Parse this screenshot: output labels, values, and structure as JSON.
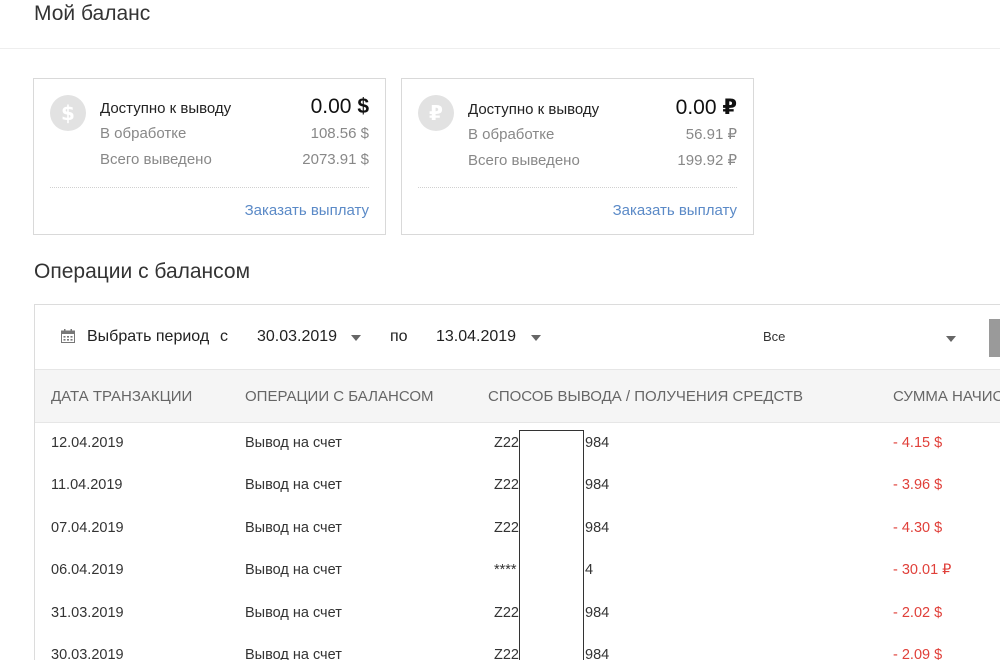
{
  "header": {
    "title": "Мой баланс"
  },
  "cards": [
    {
      "coin_icon": "dollar-coin-icon",
      "coin_symbol": "$",
      "available_label": "Доступно к выводу",
      "available_amount": "0.00",
      "currency": "$",
      "processing_label": "В обработке",
      "processing_amount": "108.56 $",
      "withdrawn_label": "Всего выведено",
      "withdrawn_amount": "2073.91 $",
      "payout_link": "Заказать выплату"
    },
    {
      "coin_icon": "ruble-coin-icon",
      "coin_symbol": "₽",
      "available_label": "Доступно к выводу",
      "available_amount": "0.00",
      "currency": "₽",
      "processing_label": "В обработке",
      "processing_amount": "56.91 ₽",
      "withdrawn_label": "Всего выведено",
      "withdrawn_amount": "199.92 ₽",
      "payout_link": "Заказать выплату"
    }
  ],
  "operations": {
    "title": "Операции с балансом",
    "filter": {
      "period_label": "Выбрать период",
      "from_label": "с",
      "from_date": "30.03.2019",
      "to_label": "по",
      "to_date": "13.04.2019",
      "type_value": "Все"
    },
    "columns": [
      "ДАТА ТРАНЗАКЦИИ",
      "ОПЕРАЦИИ С БАЛАНСОМ",
      "СПОСОБ ВЫВОДА / ПОЛУЧЕНИЯ СРЕДСТВ",
      "СУММА НАЧИС"
    ],
    "rows": [
      {
        "date": "12.04.2019",
        "operation": "Вывод на счет",
        "method_prefix": "Z22",
        "method_suffix": "984",
        "amount": "- 4.15 $"
      },
      {
        "date": "11.04.2019",
        "operation": "Вывод на счет",
        "method_prefix": "Z22",
        "method_suffix": "984",
        "amount": "- 3.96 $"
      },
      {
        "date": "07.04.2019",
        "operation": "Вывод на счет",
        "method_prefix": "Z22",
        "method_suffix": "984",
        "amount": "- 4.30 $"
      },
      {
        "date": "06.04.2019",
        "operation": "Вывод на счет",
        "method_prefix": "****",
        "method_suffix": "4",
        "amount": "- 30.01 ₽"
      },
      {
        "date": "31.03.2019",
        "operation": "Вывод на счет",
        "method_prefix": "Z22",
        "method_suffix": "984",
        "amount": "- 2.02 $"
      },
      {
        "date": "30.03.2019",
        "operation": "Вывод на счет",
        "method_prefix": "Z22",
        "method_suffix": "984",
        "amount": "- 2.09 $"
      }
    ]
  },
  "colors": {
    "link": "#5b8ac7",
    "negative": "#e0403a",
    "muted": "#888888"
  }
}
